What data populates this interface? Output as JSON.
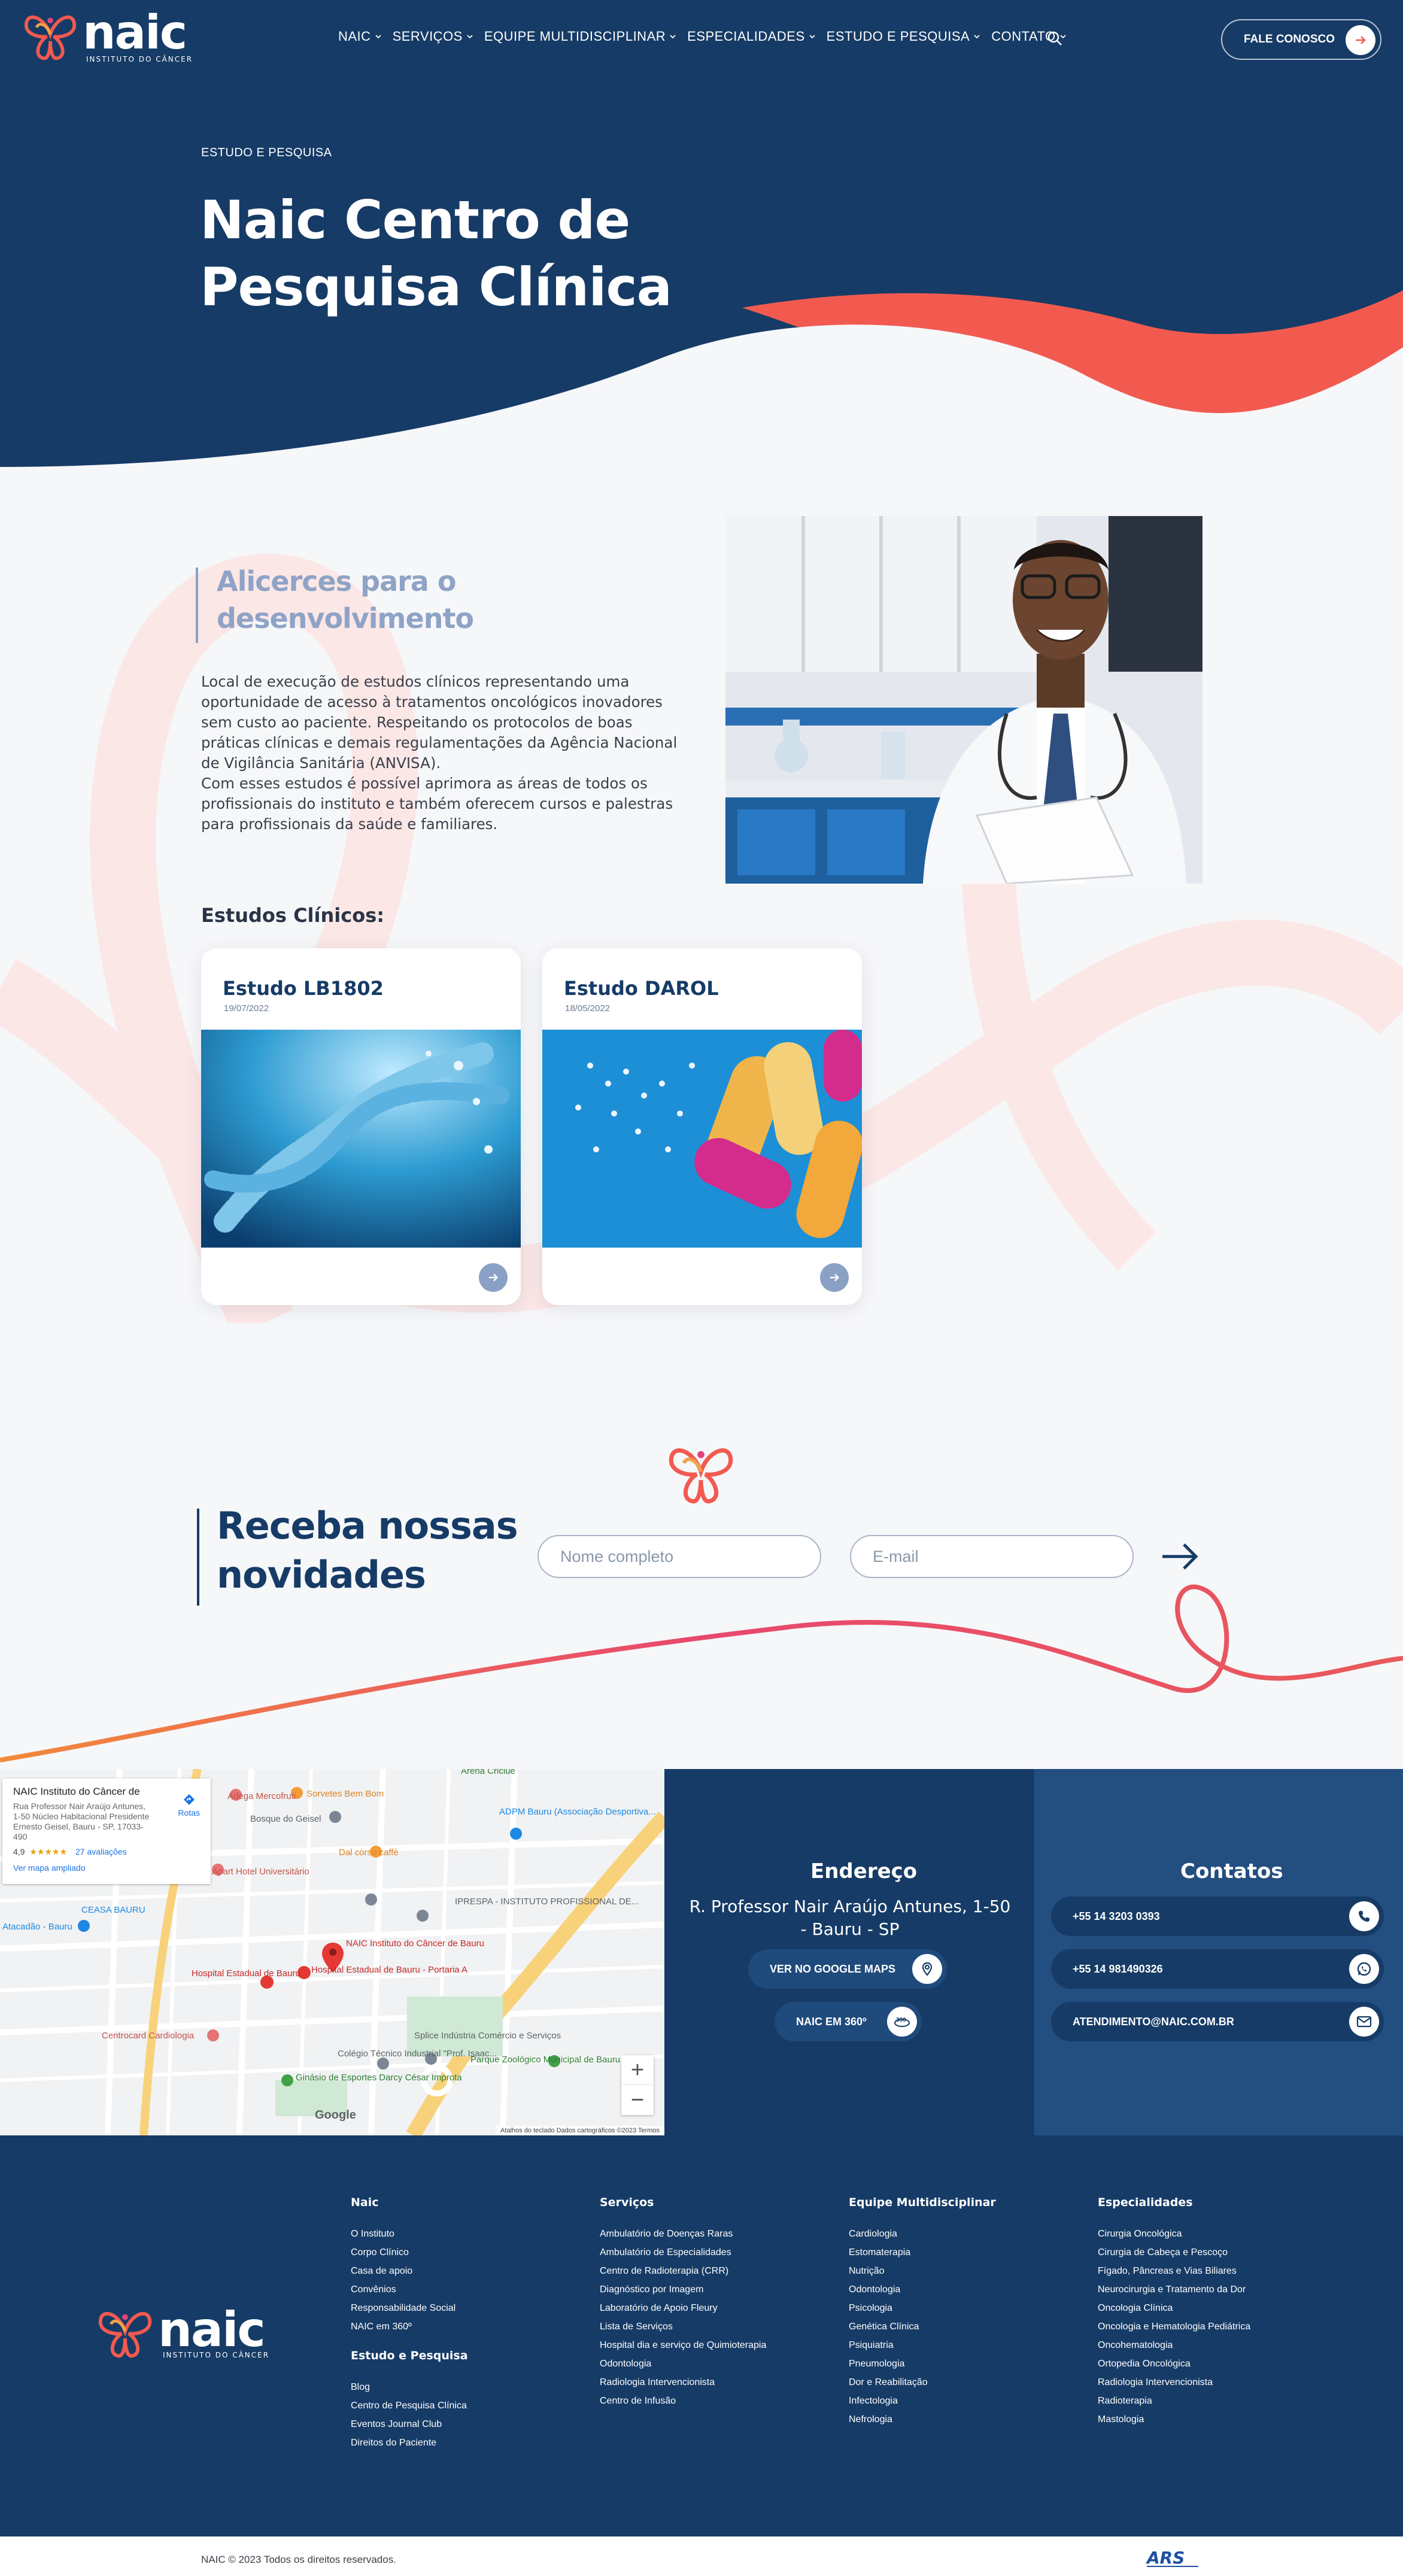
{
  "header": {
    "logo_word": "naic",
    "logo_tagline": "INSTITUTO DO CÂNCER",
    "menu": [
      {
        "label": "NAIC"
      },
      {
        "label": "SERVIÇOS"
      },
      {
        "label": "EQUIPE MULTIDISCIPLINAR"
      },
      {
        "label": "ESPECIALIDADES"
      },
      {
        "label": "ESTUDO E PESQUISA"
      },
      {
        "label": "CONTATO"
      }
    ],
    "cta_label": "FALE CONOSCO"
  },
  "hero": {
    "eyebrow": "ESTUDO E PESQUISA",
    "title": "Naic Centro de Pesquisa Clínica",
    "colors": {
      "navy": "#163b66",
      "coral": "#f25a50"
    }
  },
  "intro": {
    "subtitle": "Alicerces para o desenvolvimento",
    "paragraph_1": "Local de execução de estudos clínicos representando uma oportunidade de acesso à tratamentos oncológicos inovadores sem custo ao paciente. Respeitando os protocolos de boas práticas clínicas e demais regulamentações da Agência Nacional de Vigilância Sanitária (ANVISA).",
    "paragraph_2": "Com esses estudos é possível aprimora as áreas de todos os profissionais do instituto e também oferecem cursos e palestras para profissionais da saúde e familiares."
  },
  "studies": {
    "heading": "Estudos Clínicos:",
    "items": [
      {
        "title": "Estudo LB1802",
        "date": "19/07/2022"
      },
      {
        "title": "Estudo DAROL",
        "date": "18/05/2022"
      }
    ]
  },
  "newsletter": {
    "title_line_1": "Receba nossas",
    "title_line_2": "novidades",
    "name_placeholder": "Nome completo",
    "email_placeholder": "E-mail"
  },
  "map": {
    "place_title": "NAIC Instituto do Câncer de",
    "place_address": "Rua Professor Nair Araújo Antunes, 1-50 Núcleo Habitacional Presidente Ernesto Geisel, Bauru - SP, 17033-490",
    "rating": "4,9",
    "stars": "★★★★★",
    "reviews": "27 avaliações",
    "route_label": "Rotas",
    "larger_map": "Ver mapa ampliado",
    "zoom_in": "+",
    "zoom_out": "−",
    "attribution": "Atalhos do teclado   Dados cartográficos ©2023   Termos",
    "google": "Google",
    "labels": [
      "NAIC Instituto do Câncer de Bauru",
      "Hospital Estadual de Bauru - Portaria A",
      "Hospital Estadual de Bauru",
      "Centrocard Cardiologia",
      "Apart Hotel Universitário",
      "Bosque do Geisel",
      "ADPM Bauru (Associação Desportiva...",
      "IPRESPA - INSTITUTO PROFISSIONAL DE...",
      "Colégio Técnico Industrial \"Prof. Isaac...",
      "Ginásio de Esportes Darcy César Improta",
      "Parque Zoológico Municipal de Bauru",
      "Splice Indústria Comércio e Serviços",
      "Sorvetes Bem Bom",
      "Adega Mercofruti",
      "CEASA BAURU",
      "Atacadão - Bauru",
      "Arena Criciúe",
      "Dal corso caffè"
    ]
  },
  "address": {
    "title": "Endereço",
    "text": "R. Professor Nair Araújo Antunes, 1-50 - Bauru - SP",
    "maps_label": "VER NO GOOGLE MAPS",
    "tour_label": "NAIC EM 360º"
  },
  "contacts": {
    "title": "Contatos",
    "phone": "+55 14 3203 0393",
    "whatsapp": "+55 14 981490326",
    "email": "ATENDIMENTO@NAIC.COM.BR"
  },
  "footer": {
    "logo_word": "naic",
    "logo_tagline": "INSTITUTO DO CÂNCER",
    "col_naic": {
      "title": "Naic",
      "links": [
        "O Instituto",
        "Corpo Clínico",
        "Casa de apoio",
        "Convênios",
        "Responsabilidade Social",
        "NAIC em 360º"
      ]
    },
    "col_estudo": {
      "title": "Estudo e Pesquisa",
      "links": [
        "Blog",
        "Centro de Pesquisa Clínica",
        "Eventos Journal Club",
        "Direitos do Paciente"
      ]
    },
    "col_servicos": {
      "title": "Serviços",
      "links": [
        "Ambulatório de Doenças Raras",
        "Ambulatório de Especialidades",
        "Centro de Radioterapia (CRR)",
        "Diagnóstico por Imagem",
        "Laboratório de Apoio Fleury",
        "Lista de Serviços",
        "Hospital dia e serviço de Quimioterapia",
        "Odontologia",
        "Radiologia Intervencionista",
        "Centro de Infusão"
      ]
    },
    "col_equipe": {
      "title": "Equipe Multidisciplinar",
      "links": [
        "Cardiologia",
        "Estomaterapia",
        "Nutrição",
        "Odontologia",
        "Psicologia",
        "Genética Clínica",
        "Psiquiatria",
        "Pneumologia",
        "Dor e Reabilitação",
        "Infectologia",
        "Nefrologia"
      ]
    },
    "col_especialidades": {
      "title": "Especialidades",
      "links": [
        "Cirurgia Oncológica",
        "Cirurgia de Cabeça e Pescoço",
        "Fígado, Pâncreas e Vias Biliares",
        "Neurocirurgia e Tratamento da Dor",
        "Oncologia Clínica",
        "Oncologia e Hematologia Pediátrica",
        "Oncohematologia",
        "Ortopedia Oncológica",
        "Radiologia Intervencionista",
        "Radioterapia",
        "Mastologia"
      ]
    },
    "copyright": "NAIC © 2023 Todos os direitos reservados.",
    "agency": "ARS"
  }
}
